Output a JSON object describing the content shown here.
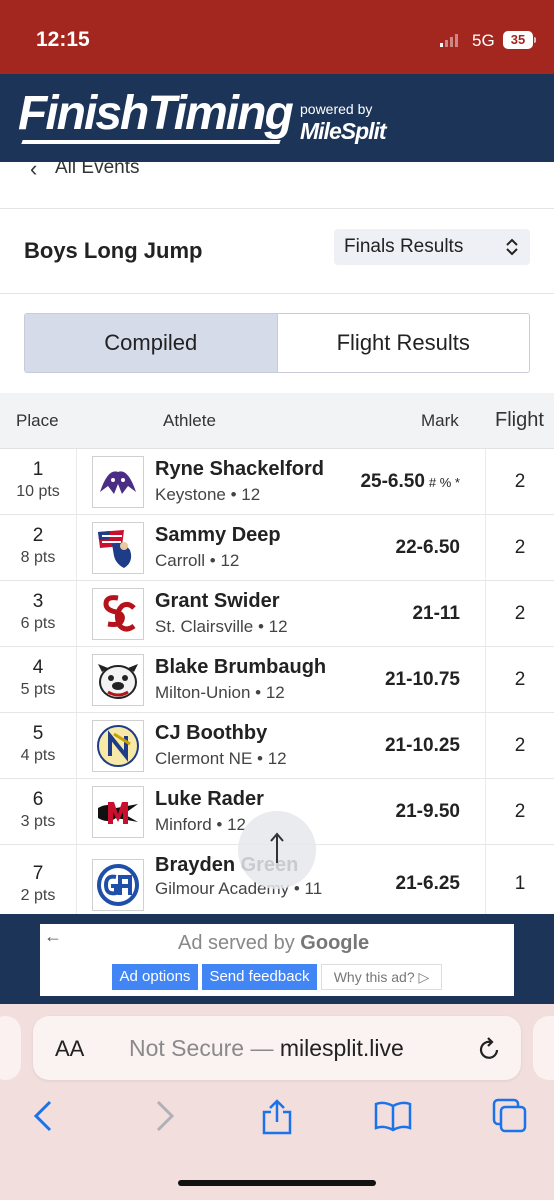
{
  "status_bar": {
    "time": "12:15",
    "network": "5G",
    "battery": "35"
  },
  "header": {
    "logo": "FinishTiming",
    "powered_by": "powered by",
    "partner": "MileSplit"
  },
  "nav": {
    "back_label": "All Events"
  },
  "event": {
    "title": "Boys Long Jump",
    "results_select": "Finals Results"
  },
  "view_toggle": {
    "compiled": "Compiled",
    "flight_results": "Flight Results",
    "active": "compiled"
  },
  "table": {
    "headers": {
      "place": "Place",
      "athlete": "Athlete",
      "mark": "Mark",
      "flight": "Flight"
    },
    "rows": [
      {
        "place": "1",
        "pts": "10 pts",
        "name": "Ryne Shackelford",
        "team": "Keystone • 12",
        "mark": "25-6.50",
        "flags": "# % *",
        "flight": "2",
        "logo_icon": "wildcat-logo-icon"
      },
      {
        "place": "2",
        "pts": "8 pts",
        "name": "Sammy Deep",
        "team": "Carroll • 12",
        "mark": "22-6.50",
        "flags": "",
        "flight": "2",
        "logo_icon": "patriot-logo-icon"
      },
      {
        "place": "3",
        "pts": "6 pts",
        "name": "Grant Swider",
        "team": "St. Clairsville • 12",
        "mark": "21-11",
        "flags": "",
        "flight": "2",
        "logo_icon": "sc-logo-icon"
      },
      {
        "place": "4",
        "pts": "5 pts",
        "name": "Blake Brumbaugh",
        "team": "Milton-Union • 12",
        "mark": "21-10.75",
        "flags": "",
        "flight": "2",
        "logo_icon": "bulldog-logo-icon"
      },
      {
        "place": "5",
        "pts": "4 pts",
        "name": "CJ Boothby",
        "team": "Clermont NE • 12",
        "mark": "21-10.25",
        "flags": "",
        "flight": "2",
        "logo_icon": "rockets-logo-icon"
      },
      {
        "place": "6",
        "pts": "3 pts",
        "name": "Luke Rader",
        "team": "Minford • 12",
        "mark": "21-9.50",
        "flags": "",
        "flight": "2",
        "logo_icon": "falcon-logo-icon"
      },
      {
        "place": "7",
        "pts": "2 pts",
        "name": "Brayden Green",
        "team": "Gilmour Academy • 11",
        "mark": "21-6.25",
        "flags": "",
        "flight": "1",
        "logo_icon": "ga-logo-icon"
      }
    ]
  },
  "ad": {
    "served_by": "Ad served by",
    "brand": "Google",
    "options": "Ad options",
    "feedback": "Send feedback",
    "why": "Why this ad? ▷"
  },
  "browser": {
    "aa": "AA",
    "security": "Not Secure —",
    "host": "milesplit.live"
  },
  "colors": {
    "status_red": "#a3271f",
    "navy": "#1b3457",
    "google_blue": "#4285f4",
    "ios_blue": "#1a73e8"
  }
}
